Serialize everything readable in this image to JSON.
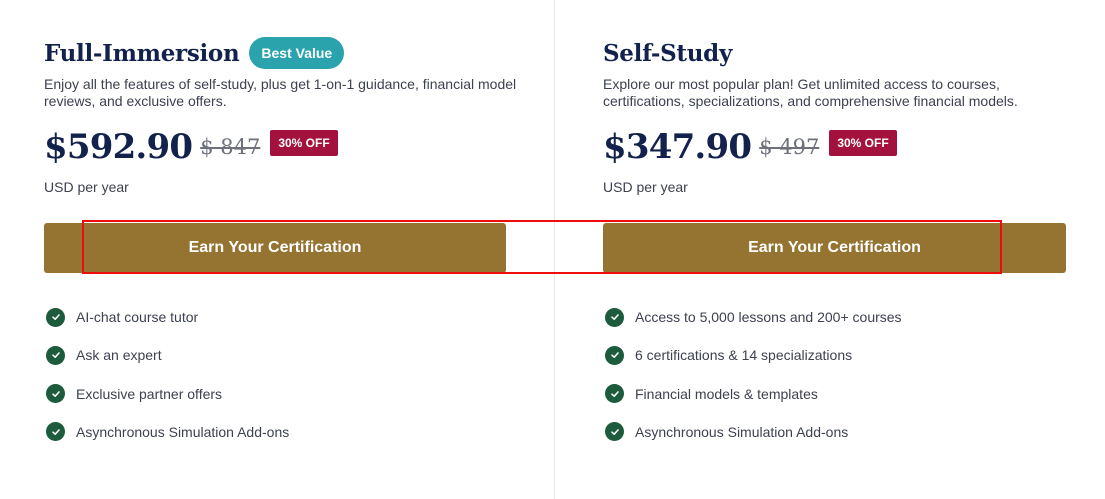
{
  "plans": [
    {
      "title": "Full-Immersion",
      "badge": "Best Value",
      "description": "Enjoy all the features of self-study, plus get 1-on-1 guidance, financial model reviews, and exclusive offers.",
      "price": "$592.90",
      "old_price": "$ 847",
      "discount": "30% OFF",
      "period": "USD per year",
      "cta_label": "Earn Your Certification",
      "features": [
        "AI-chat course tutor",
        "Ask an expert",
        "Exclusive partner offers",
        "Asynchronous Simulation Add-ons"
      ]
    },
    {
      "title": "Self-Study",
      "description": "Explore our most popular plan! Get unlimited access to courses, certifications, specializations, and comprehensive financial models.",
      "price": "$347.90",
      "old_price": "$ 497",
      "discount": "30% OFF",
      "period": "USD per year",
      "cta_label": "Earn Your Certification",
      "features": [
        "Access to 5,000 lessons and 200+ courses",
        "6 certifications & 14 specializations",
        "Financial models & templates",
        "Asynchronous Simulation Add-ons"
      ]
    }
  ],
  "icons": {
    "feature_check": "check-circle-icon"
  },
  "colors": {
    "title": "#13224d",
    "badge": "#2aa3ad",
    "discount": "#a3123f",
    "cta": "#957331",
    "check": "#1c5b3b",
    "highlight": "#ee0d0d"
  }
}
